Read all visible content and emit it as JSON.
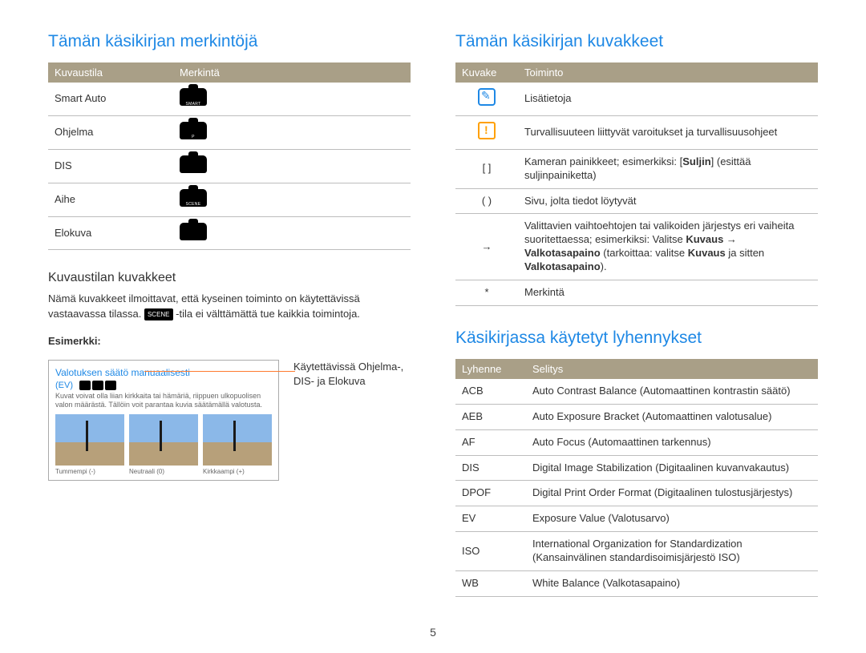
{
  "page_number": "5",
  "left": {
    "heading": "Tämän käsikirjan merkintöjä",
    "table1": {
      "headers": [
        "Kuvaustila",
        "Merkintä"
      ],
      "rows": [
        {
          "mode": "Smart Auto",
          "icon_label": "SMART"
        },
        {
          "mode": "Ohjelma",
          "icon_label": "P"
        },
        {
          "mode": "DIS",
          "icon_label": ""
        },
        {
          "mode": "Aihe",
          "icon_label": "SCENE"
        },
        {
          "mode": "Elokuva",
          "icon_label": ""
        }
      ]
    },
    "sub_heading": "Kuvaustilan kuvakkeet",
    "paragraph_pre": "Nämä kuvakkeet ilmoittavat, että kyseinen toiminto on käytettävissä vastaavassa tilassa. ",
    "scene_chip": "SCENE",
    "paragraph_post": "-tila ei välttämättä tue kaikkia toimintoja.",
    "example_label": "Esimerkki:",
    "example": {
      "title": "Valotuksen säätö manuaalisesti",
      "subtitle": "(EV)",
      "desc": "Kuvat voivat olla liian kirkkaita tai hämäriä, riippuen ulkopuolisen valon määrästä. Tällöin voit parantaa kuvia säätämällä valotusta.",
      "thumbs": [
        "Tummempi (-)",
        "Neutraali (0)",
        "Kirkkaampi (+)"
      ]
    },
    "callout": "Käytettävissä Ohjelma-, DIS- ja Elokuva"
  },
  "right": {
    "heading1": "Tämän käsikirjan kuvakkeet",
    "table2": {
      "headers": [
        "Kuvake",
        "Toiminto"
      ],
      "rows": [
        {
          "icon": "info",
          "text": "Lisätietoja"
        },
        {
          "icon": "warn",
          "text": "Turvallisuuteen liittyvät varoitukset ja turvallisuusohjeet"
        },
        {
          "icon": "brackets",
          "symbol": "[  ]",
          "text_html": "Kameran painikkeet; esimerkiksi: [<b>Suljin</b>] (esittää suljinpainiketta)"
        },
        {
          "icon": "parens",
          "symbol": "(  )",
          "text": "Sivu, jolta tiedot löytyvät"
        },
        {
          "icon": "arrow",
          "symbol": "→",
          "text_html": "Valittavien vaihtoehtojen tai valikoiden järjestys eri vaiheita suoritettaessa; esimerkiksi: Valitse <b>Kuvaus</b> → <b>Valkotasapaino</b> (tarkoittaa: valitse <b>Kuvaus</b> ja sitten <b>Valkotasapaino</b>)."
        },
        {
          "icon": "star",
          "symbol": "*",
          "text": "Merkintä"
        }
      ]
    },
    "heading2": "Käsikirjassa käytetyt lyhennykset",
    "table3": {
      "headers": [
        "Lyhenne",
        "Selitys"
      ],
      "rows": [
        {
          "abbr": "ACB",
          "def": "Auto Contrast Balance (Automaattinen kontrastin säätö)"
        },
        {
          "abbr": "AEB",
          "def": "Auto Exposure Bracket (Automaattinen valotusalue)"
        },
        {
          "abbr": "AF",
          "def": "Auto Focus (Automaattinen tarkennus)"
        },
        {
          "abbr": "DIS",
          "def": "Digital Image Stabilization (Digitaalinen kuvanvakautus)"
        },
        {
          "abbr": "DPOF",
          "def": "Digital Print Order Format (Digitaalinen tulostusjärjestys)"
        },
        {
          "abbr": "EV",
          "def": "Exposure Value (Valotusarvo)"
        },
        {
          "abbr": "ISO",
          "def": "International Organization for Standardization (Kansainvälinen standardisoimisjärjestö ISO)"
        },
        {
          "abbr": "WB",
          "def": "White Balance (Valkotasapaino)"
        }
      ]
    }
  }
}
